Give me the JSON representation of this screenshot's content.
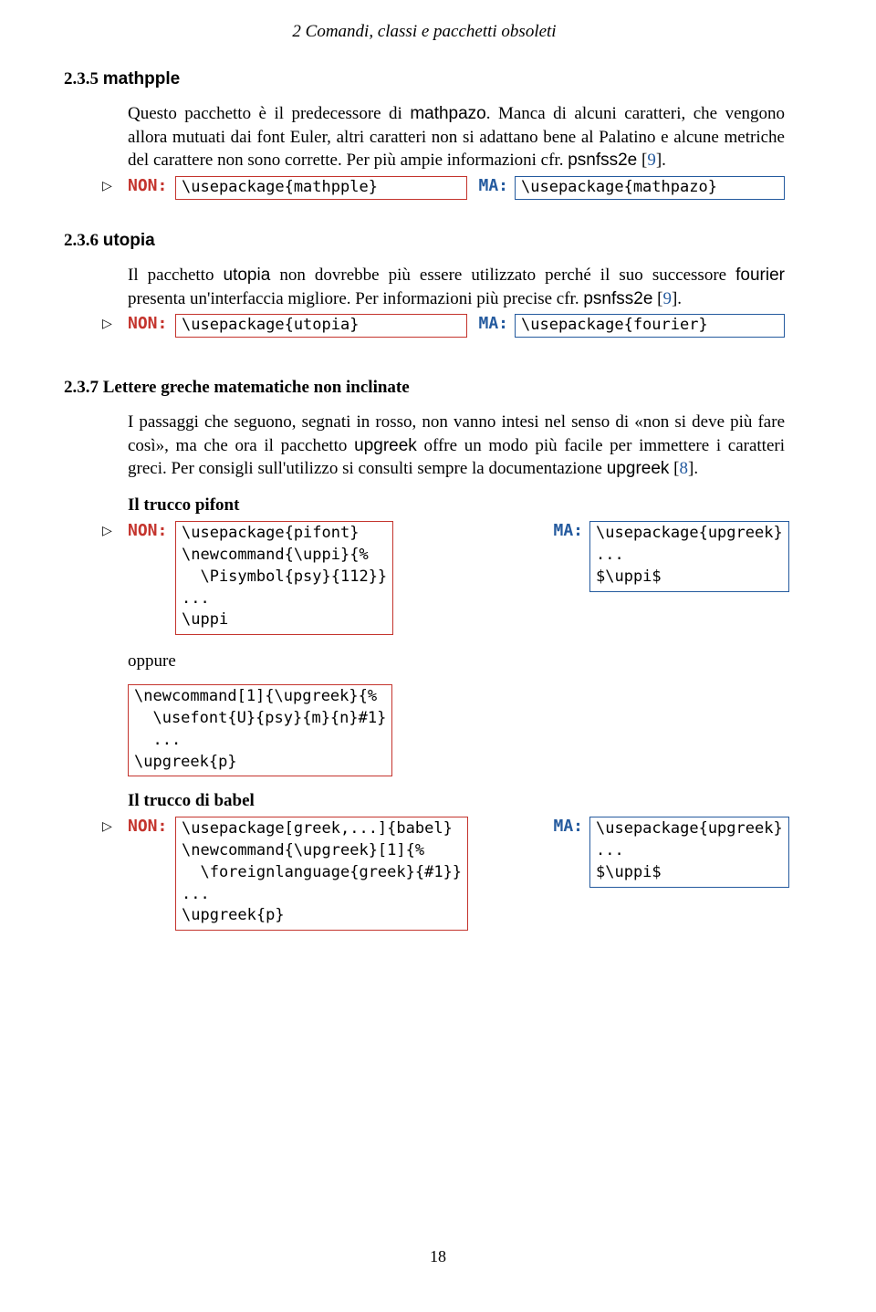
{
  "header": {
    "chapter": "2 Comandi, classi e pacchetti obsoleti"
  },
  "s235": {
    "num": "2.3.5",
    "title": "mathpple",
    "para_pre": "Questo pacchetto è il predecessore di ",
    "pkg": "mathpazo",
    "para_mid": ". Manca di alcuni caratteri, che vengono allora mutuati dai font Euler, altri caratteri non si adattano bene al Palatino e alcune metriche del carattere non sono corrette. Per più ampie informazioni cfr. ",
    "psn": "psnfss2e",
    "cite_open": " [",
    "cite9": "9",
    "cite_close": "].",
    "non_label": "NON:",
    "non_code": "\\usepackage{mathpple}",
    "ma_label": "MA:",
    "ma_code": "\\usepackage{mathpazo}"
  },
  "s236": {
    "num": "2.3.6",
    "title": "utopia",
    "para_pre": "Il pacchetto ",
    "pkg1": "utopia",
    "para_mid1": " non dovrebbe più essere utilizzato perché il suo successore ",
    "pkg2": "fourier",
    "para_mid2": " presenta un'interfaccia migliore. Per informazioni più precise cfr. ",
    "psn": "psnfss2e",
    "cite_open": " [",
    "cite9": "9",
    "cite_close": "].",
    "non_label": "NON:",
    "non_code": "\\usepackage{utopia}",
    "ma_label": "MA:",
    "ma_code": "\\usepackage{fourier}"
  },
  "s237": {
    "num": "2.3.7",
    "title_rest": "Lettere greche matematiche non inclinate",
    "para_pre": "I passaggi che seguono, segnati in rosso, non vanno intesi nel senso di «non si deve più fare così», ma che ora il pacchetto ",
    "pkg": "upgreek",
    "para_mid": " offre un modo più facile per immettere i caratteri greci. Per consigli sull'utilizzo si consulti sempre la documentazione ",
    "pkg2": "upgreek",
    "cite_open": " [",
    "cite8": "8",
    "cite_close": "].",
    "trick1_title": "Il trucco pifont",
    "non_label": "NON:",
    "non_block": "\\usepackage{pifont}\n\\newcommand{\\uppi}{%\n  \\Pisymbol{psy}{112}}\n...\n\\uppi",
    "ma_label": "MA:",
    "ma_block": "\\usepackage{upgreek}\n...\n$\\uppi$",
    "oppure": "oppure",
    "alt_block": "\\newcommand[1]{\\upgreek}{%\n  \\usefont{U}{psy}{m}{n}#1}\n  ...\n\\upgreek{p}",
    "trick2_title": "Il trucco di babel",
    "non2_block": "\\usepackage[greek,...]{babel}\n\\newcommand{\\upgreek}[1]{%\n  \\foreignlanguage{greek}{#1}}\n...\n\\upgreek{p}",
    "ma2_block": "\\usepackage{upgreek}\n...\n$\\uppi$"
  },
  "pageno": "18"
}
